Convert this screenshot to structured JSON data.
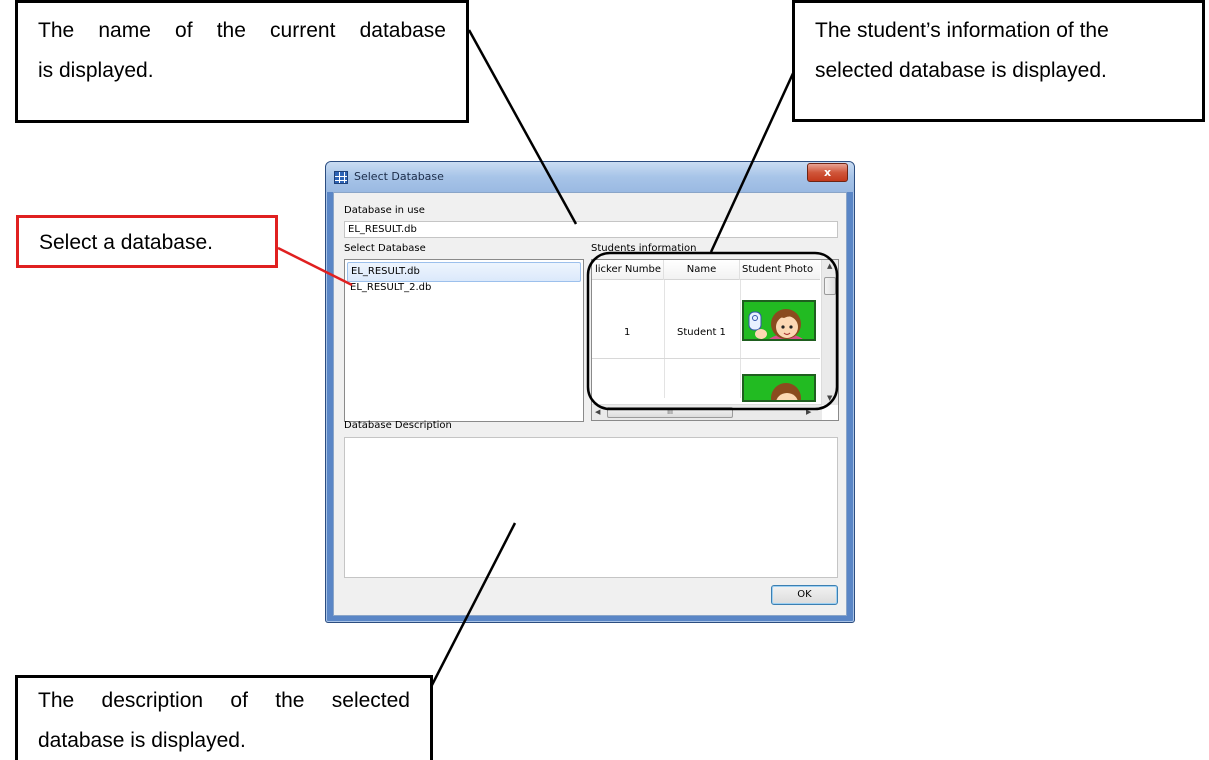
{
  "callouts": {
    "top_left": [
      "The name of the current database",
      "is displayed."
    ],
    "top_right": [
      "The student’s information of the",
      "selected database is displayed."
    ],
    "select": "Select a database.",
    "bottom": [
      "The description of the selected",
      "database is displayed."
    ]
  },
  "dialog": {
    "title": "Select Database",
    "close_symbol": "x",
    "database_in_use_label": "Database in use",
    "database_in_use_value": "EL_RESULT.db",
    "select_database_label": "Select Database",
    "databases": [
      "EL_RESULT.db",
      "EL_RESULT_2.db"
    ],
    "students_information_label": "Students information",
    "grid": {
      "headers": [
        "licker Numbe",
        "Name",
        "Student Photo"
      ],
      "rows": [
        {
          "number": "1",
          "name": "Student 1"
        }
      ]
    },
    "scroll_glyph": "III",
    "description_label": "Database Description",
    "ok_label": "OK"
  },
  "colors": {
    "callout_border": "#000000",
    "select_callout_border": "#e02020",
    "photo_background": "#22bb22"
  }
}
